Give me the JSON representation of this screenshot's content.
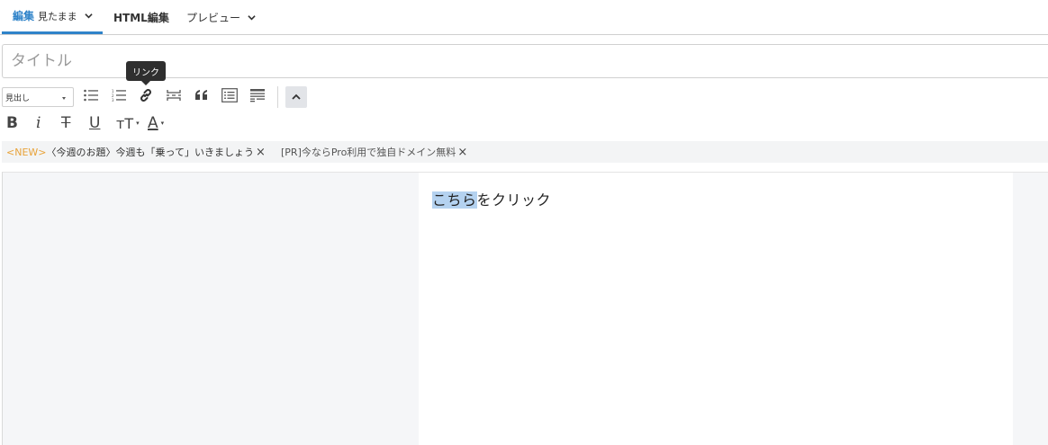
{
  "tabs": {
    "edit_label": "編集",
    "edit_mode": "見たまま",
    "html_label": "HTML編集",
    "preview_label": "プレビュー"
  },
  "title_field": {
    "placeholder": "タイトル",
    "value": ""
  },
  "toolbar": {
    "heading_select": "見出し",
    "tooltip": "リンク",
    "icons": [
      "bulleted-list-icon",
      "numbered-list-icon",
      "link-icon",
      "more-separator-icon",
      "blockquote-icon",
      "table-of-contents-icon",
      "summary-icon",
      "collapse-icon"
    ],
    "format_icons": [
      "bold-icon",
      "italic-icon",
      "strikethrough-icon",
      "underline-icon",
      "font-size-icon",
      "text-color-icon"
    ]
  },
  "format": {
    "bold": "B",
    "italic": "i",
    "strike": "T",
    "underline": "U",
    "font_size": "тT",
    "text_color": "A"
  },
  "notices": {
    "first_tag": "<NEW>",
    "first_text": "〈今週のお題〉今週も「乗って」いきましょう",
    "second_text": "[PR]今ならPro利用で独自ドメイン無料",
    "close": "×"
  },
  "editor": {
    "selected_text": "こちら",
    "rest_text": "をクリック"
  },
  "colors": {
    "accent": "#2f83c9",
    "new_tag": "#e8a33a",
    "selection": "#b4d2f0"
  }
}
